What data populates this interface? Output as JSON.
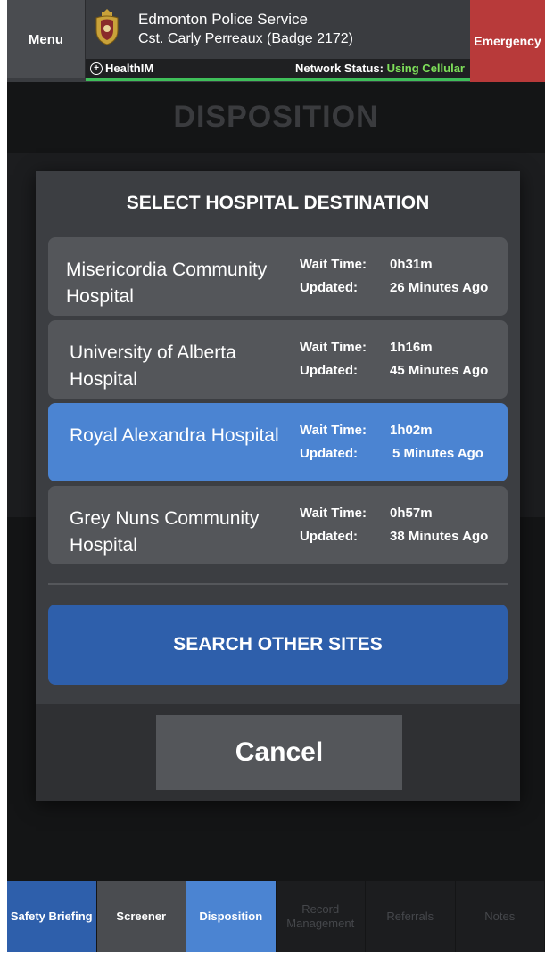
{
  "header": {
    "menu_label": "Menu",
    "org_name": "Edmonton Police Service",
    "officer": "Cst. Carly Perreaux (Badge 2172)",
    "emergency_label": "Emergency",
    "brand": "HealthIM",
    "network_label": "Network Status:",
    "network_value": "Using Cellular",
    "network_color": "#7ee05a"
  },
  "background": {
    "title": "DISPOSITION"
  },
  "modal": {
    "title": "SELECT HOSPITAL DESTINATION",
    "wait_label": "Wait Time:",
    "updated_label": "Updated:",
    "hospitals": [
      {
        "name": "Misericordia Community Hospital",
        "wait": "0h31m",
        "updated": "26 Minutes Ago",
        "selected": false
      },
      {
        "name": "University of Alberta Hospital",
        "wait": "1h16m",
        "updated": "45 Minutes Ago",
        "selected": false
      },
      {
        "name": "Royal Alexandra Hospital",
        "wait": "1h02m",
        "updated": "5 Minutes Ago",
        "selected": true
      },
      {
        "name": "Grey Nuns Community Hospital",
        "wait": "0h57m",
        "updated": "38 Minutes Ago",
        "selected": false
      }
    ],
    "search_label": "SEARCH OTHER SITES",
    "cancel_label": "Cancel"
  },
  "tabs": [
    {
      "label": "Safety Briefing",
      "state": "done"
    },
    {
      "label": "Screener",
      "state": "normal"
    },
    {
      "label": "Disposition",
      "state": "active"
    },
    {
      "label": "Record Management",
      "state": "disabled"
    },
    {
      "label": "Referrals",
      "state": "disabled"
    },
    {
      "label": "Notes",
      "state": "disabled"
    }
  ],
  "colors": {
    "header_bg": "#3a3c40",
    "emergency": "#b83a3a",
    "selected": "#4b84d2",
    "primary_button": "#2e5fab"
  }
}
